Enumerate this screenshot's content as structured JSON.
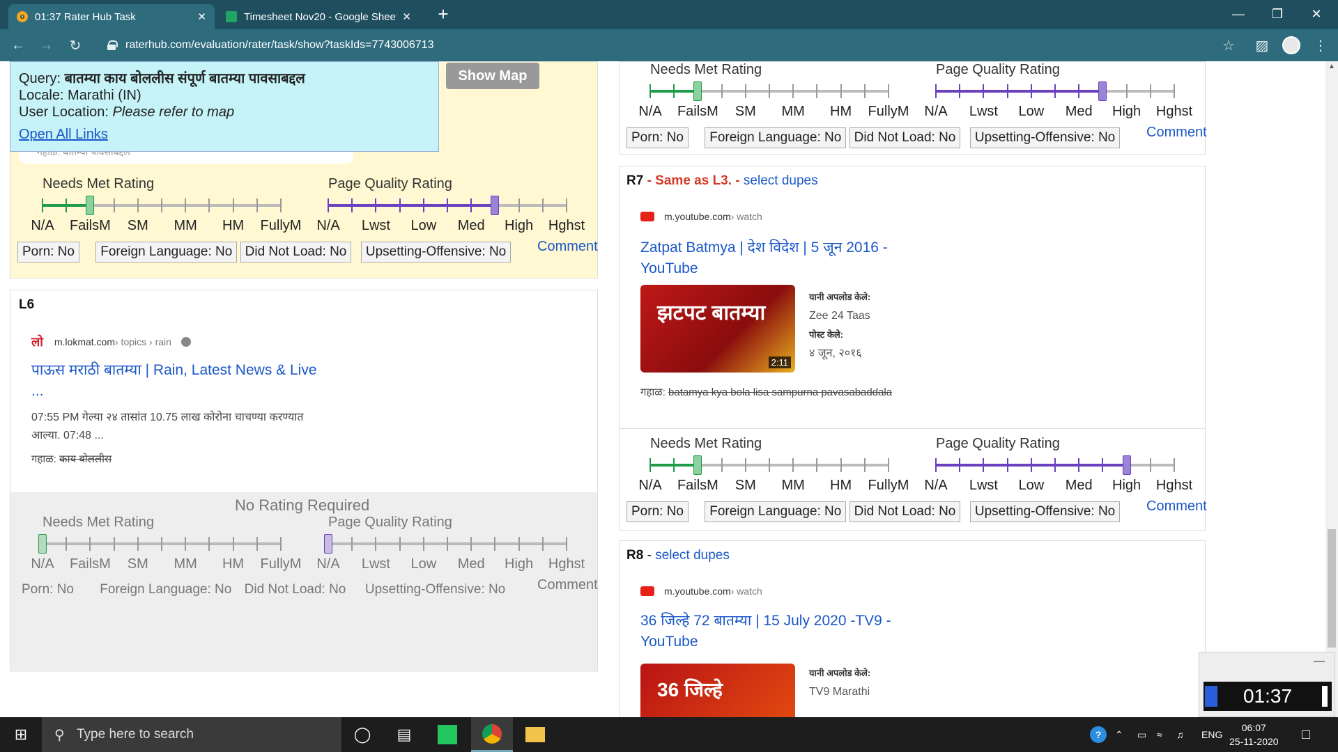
{
  "browser": {
    "tabs": [
      {
        "label": "01:37 Rater Hub Task",
        "close": "✕"
      },
      {
        "label": "Timesheet Nov20 - Google Sheet",
        "close": "✕"
      }
    ],
    "new_tab": "+",
    "url": "raterhub.com/evaluation/rater/task/show?taskIds=7743006713"
  },
  "query_popup": {
    "query_label": "Query:",
    "query_value": "बातम्या काय बोललीस संपूर्ण बातम्या पावसाबद्दल",
    "locale": "Locale: Marathi (IN)",
    "user_location_label": "User Location:",
    "user_location_value": "Please refer to map",
    "open_all_links": "Open All Links",
    "show_map": "Show Map",
    "hidden_line": "गहाळ: बातम्या पावसाबद्दल"
  },
  "scale": {
    "needs_met_title": "Needs Met Rating",
    "page_quality_title": "Page Quality Rating",
    "nm_labels": [
      "N/A",
      "FailsM",
      "SM",
      "MM",
      "HM",
      "FullyM"
    ],
    "pq_labels": [
      "N/A",
      "Lwst",
      "Low",
      "Med",
      "High",
      "Hghst"
    ],
    "flags": [
      "Porn: No",
      "Foreign Language: No",
      "Did Not Load: No",
      "Upsetting-Offensive: No"
    ],
    "comment": "Comment",
    "no_rating": "No Rating Required"
  },
  "ratings": {
    "left_top": {
      "needs_met": "FailsM",
      "page_quality": "Med+"
    },
    "left_l6": {
      "needs_met": "N/A",
      "page_quality": "N/A"
    },
    "right_top": {
      "needs_met": "FailsM",
      "page_quality": "Med+"
    },
    "right_r7": {
      "needs_met": "FailsM",
      "page_quality": "High"
    }
  },
  "l6": {
    "label": "L6",
    "site_logo": "लो",
    "site": "m.lokmat.com",
    "path": " › topics › rain",
    "title": "पाऊस मराठी बातम्या | Rain, Latest News & Live ...",
    "snippet": "07:55 PM गेल्या २४ तासांत 10.75 लाख कोरोना चाचण्या करण्यात आल्या. 07:48 ...",
    "missing_label": "गहाळ:",
    "missing_terms": "काय बोललीस"
  },
  "r7": {
    "label": "R7",
    "same_as": " - Same as L3. - ",
    "select_dupes": "select dupes",
    "site": "m.youtube.com",
    "path": " › watch",
    "title": "Zatpat Batmya | देश विदेश | 5 जून 2016 - YouTube",
    "thumb_text": "झटपट बातम्या",
    "duration": "2:11",
    "uploaded_by_label": "यानी अपलोड केले:",
    "uploaded_by": "Zee 24 Taas",
    "posted_label": "पोस्ट केले:",
    "posted": "४ जून, २०१६",
    "missing_label": "गहाळ:",
    "missing_terms": "batamya kya bola lisa sampurna pavasabaddala"
  },
  "r8": {
    "label": "R8",
    "sep": " - ",
    "select_dupes": "select dupes",
    "site": "m.youtube.com",
    "path": " › watch",
    "title": "36 जिल्हे 72 बातम्या | 15 July 2020 -TV9 - YouTube",
    "thumb_text": "36 जिल्हे",
    "uploaded_by_label": "यानी अपलोड केले:",
    "uploaded_by": "TV9 Marathi"
  },
  "timer": {
    "time": "01:37",
    "minimize": "—"
  },
  "taskbar": {
    "search_placeholder": "Type here to search",
    "lang": "ENG",
    "time": "06:07",
    "date": "25-11-2020"
  },
  "colors": {
    "needs_met": "#1e9c4a",
    "page_quality": "#6a3fc0",
    "link": "#1a57c7"
  }
}
